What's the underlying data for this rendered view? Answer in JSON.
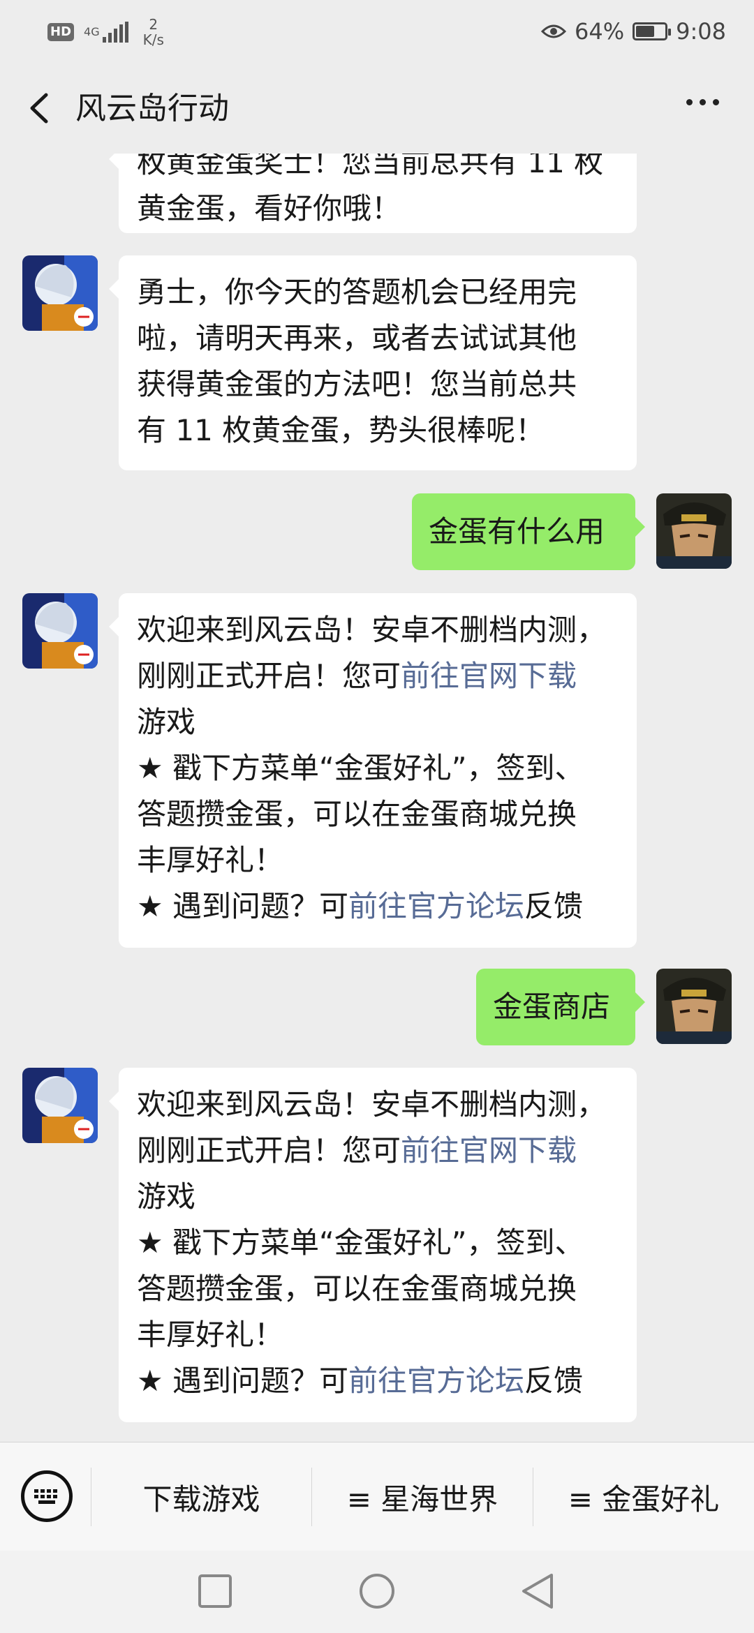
{
  "status": {
    "hd": "HD",
    "network": "4G",
    "speed_value": "2",
    "speed_unit": "K/s",
    "battery": "64%",
    "battery_level": 0.64,
    "time": "9:08"
  },
  "header": {
    "title": "风云岛行动"
  },
  "messages": {
    "m0": {
      "lines": [
        "枚黄金蛋奖士！您当前总共有 11 枚",
        "黄金蛋，看好你哦！"
      ]
    },
    "m1": {
      "lines": [
        "勇士，你今天的答题机会已经用完",
        "啦，请明天再来，或者去试试其他",
        "获得黄金蛋的方法吧！您当前总共",
        "有 11 枚黄金蛋，势头很棒呢！"
      ]
    },
    "m2": {
      "text": "金蛋有什么用"
    },
    "m3": {
      "l1": "欢迎来到风云岛！安卓不删档内测，",
      "l2a": "刚刚正式开启！您可",
      "l2link": "前往官网下载",
      "l3": "游戏",
      "l4": "★ 戳下方菜单“金蛋好礼”，签到、",
      "l5": "答题攒金蛋，可以在金蛋商城兑换",
      "l6": "丰厚好礼！",
      "l7a": "★ 遇到问题？可",
      "l7link": "前往官方论坛",
      "l7b": "反馈"
    },
    "m4": {
      "text": "金蛋商店"
    },
    "m5": {
      "l1": "欢迎来到风云岛！安卓不删档内测，",
      "l2a": "刚刚正式开启！您可",
      "l2link": "前往官网下载",
      "l3": "游戏",
      "l4": "★ 戳下方菜单“金蛋好礼”，签到、",
      "l5": "答题攒金蛋，可以在金蛋商城兑换",
      "l6": "丰厚好礼！",
      "l7a": "★ 遇到问题？可",
      "l7link": "前往官方论坛",
      "l7b": "反馈"
    }
  },
  "menu": {
    "item1": "下载游戏",
    "item2": "≡ 星海世界",
    "item3": "≡ 金蛋好礼"
  }
}
